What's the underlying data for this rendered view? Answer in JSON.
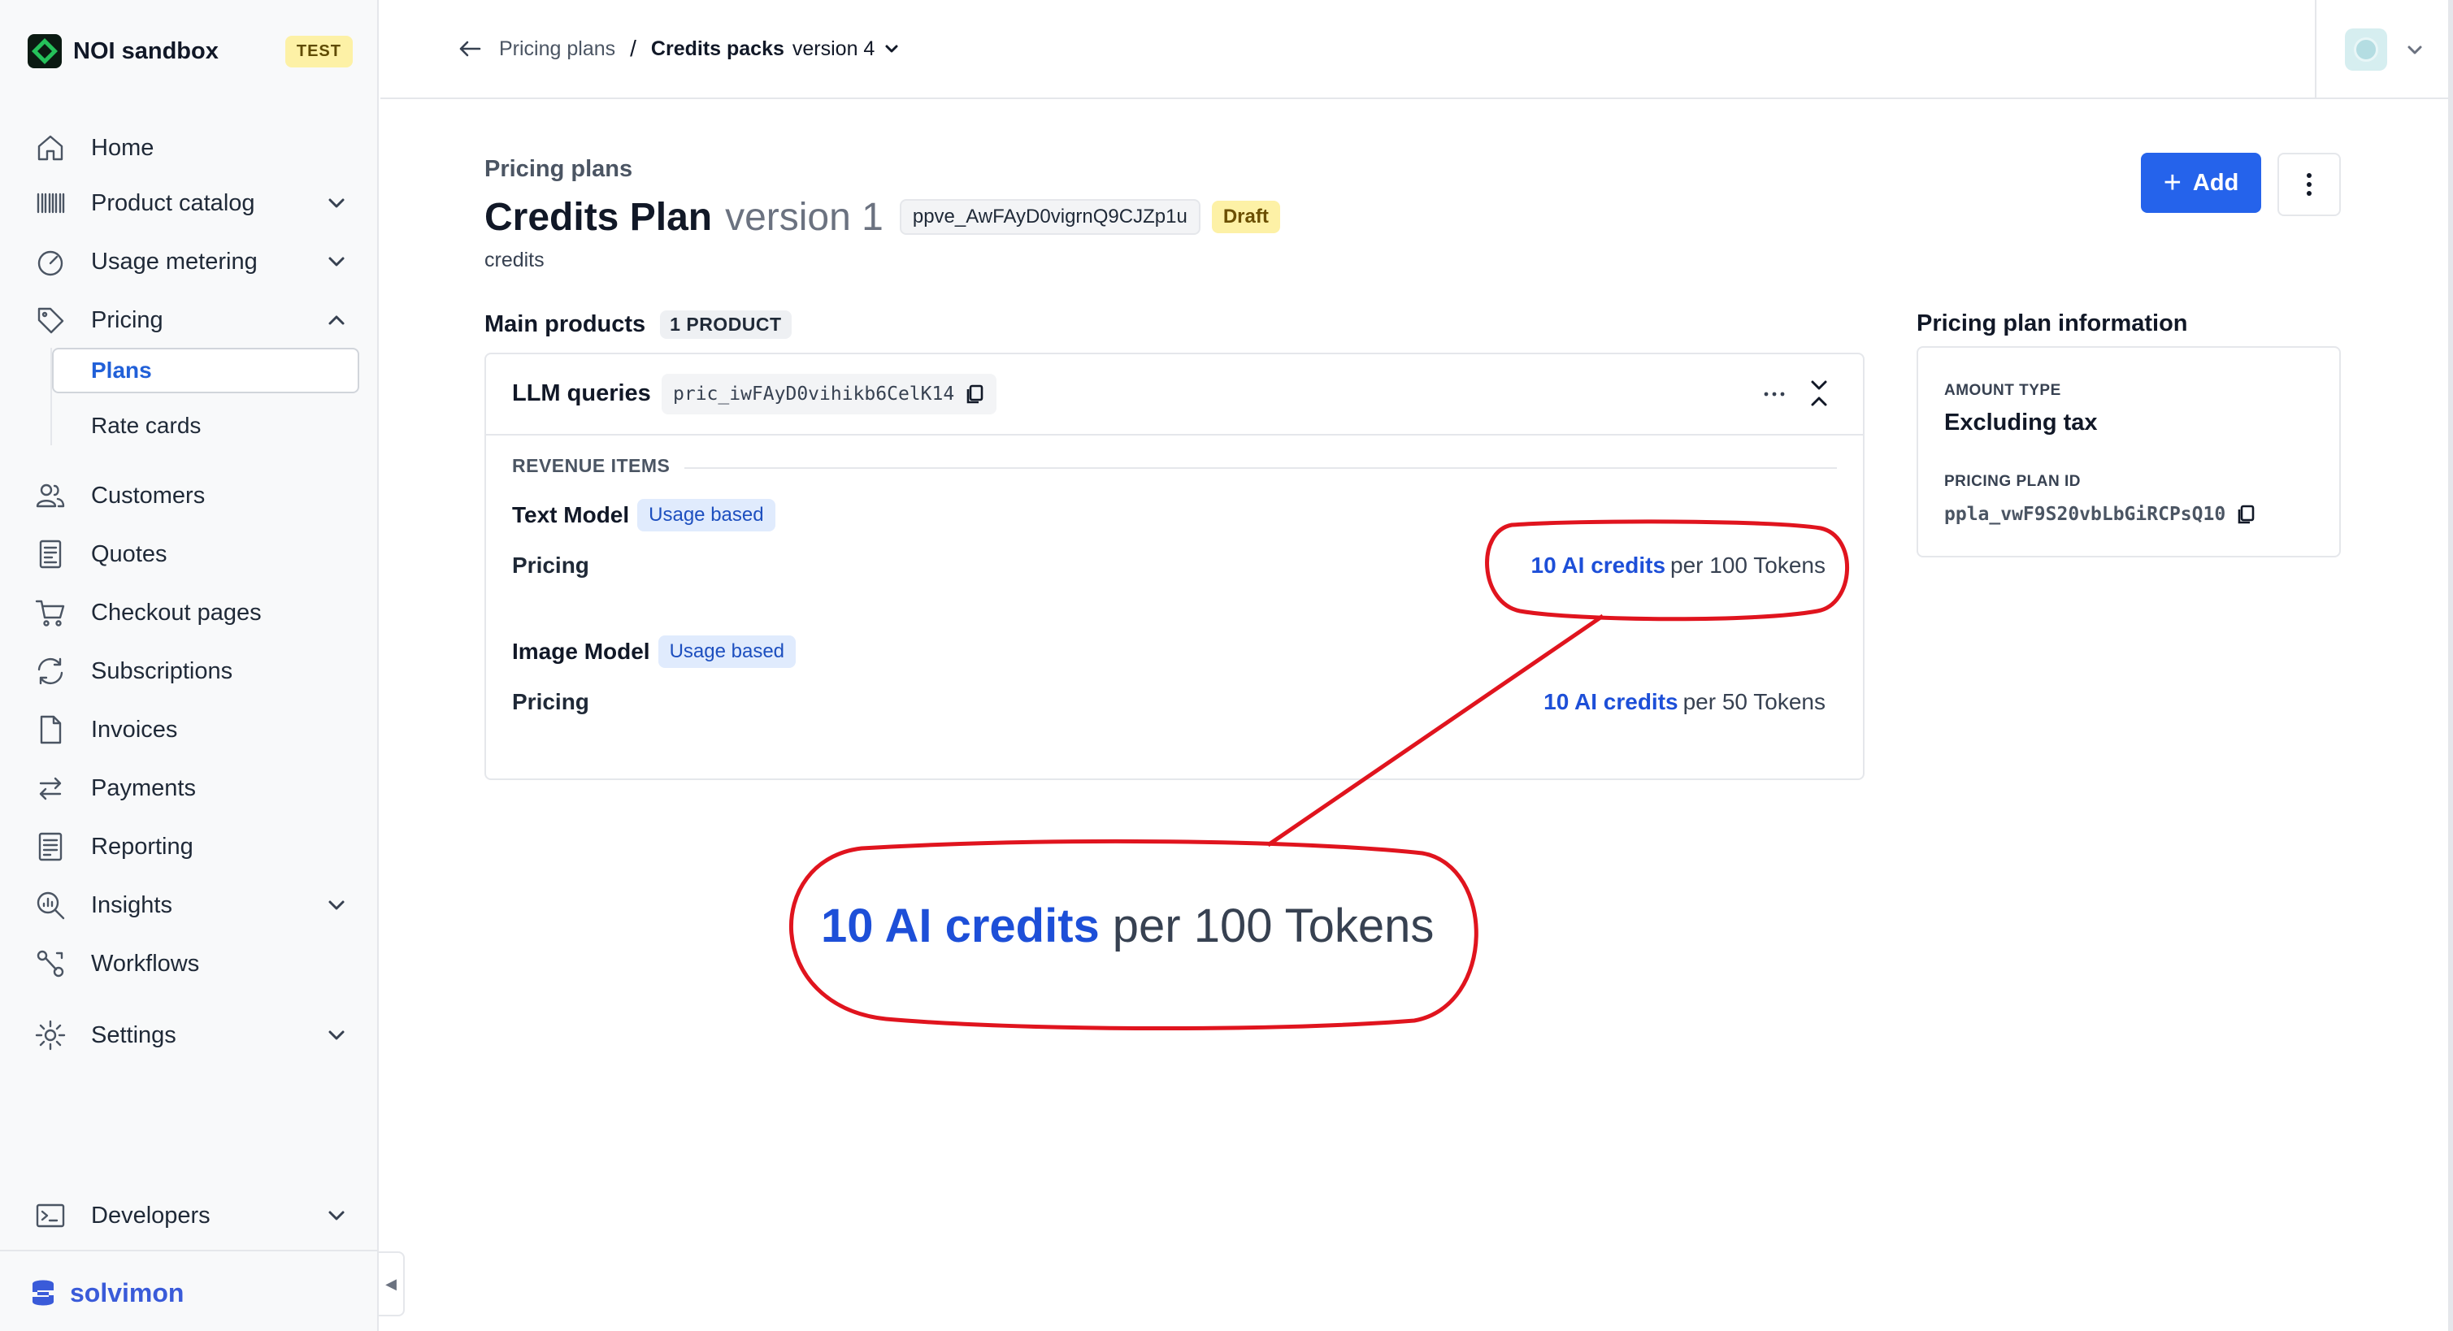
{
  "org": {
    "name": "NOI sandbox",
    "env_badge": "TEST"
  },
  "nav": {
    "items": [
      {
        "label": "Home",
        "icon": "home-icon"
      },
      {
        "label": "Product catalog",
        "icon": "barcode-icon"
      },
      {
        "label": "Usage metering",
        "icon": "gauge-icon"
      },
      {
        "label": "Pricing",
        "icon": "tag-icon"
      },
      {
        "label": "Customers",
        "icon": "users-icon"
      },
      {
        "label": "Quotes",
        "icon": "quote-doc-icon"
      },
      {
        "label": "Checkout pages",
        "icon": "cart-icon"
      },
      {
        "label": "Subscriptions",
        "icon": "refresh-icon"
      },
      {
        "label": "Invoices",
        "icon": "file-icon"
      },
      {
        "label": "Payments",
        "icon": "transfer-icon"
      },
      {
        "label": "Reporting",
        "icon": "report-icon"
      },
      {
        "label": "Insights",
        "icon": "insights-icon"
      },
      {
        "label": "Workflows",
        "icon": "workflow-icon"
      },
      {
        "label": "Settings",
        "icon": "gear-icon"
      },
      {
        "label": "Developers",
        "icon": "terminal-icon"
      }
    ],
    "pricing_sub": [
      {
        "label": "Plans",
        "active": true
      },
      {
        "label": "Rate cards",
        "active": false
      }
    ]
  },
  "brand": {
    "name": "solvimon"
  },
  "breadcrumb": {
    "parent": "Pricing plans",
    "separator": "/",
    "current": "Credits packs",
    "version": "version 4"
  },
  "page": {
    "eyebrow": "Pricing plans",
    "title": "Credits Plan",
    "version": "version 1",
    "id": "ppve_AwFAyD0vigrnQ9CJZp1u",
    "status": "Draft",
    "code": "credits",
    "add_label": "Add"
  },
  "main_products": {
    "title": "Main products",
    "count": "1 PRODUCT",
    "product": {
      "name": "LLM queries",
      "price_id": "pric_iwFAyD0vihikb6CelK14",
      "revenue_label": "REVENUE ITEMS",
      "items": [
        {
          "name": "Text Model",
          "badge": "Usage based",
          "pricing_label": "Pricing",
          "amount": "10 AI credits",
          "rate": "per 100 Tokens"
        },
        {
          "name": "Image Model",
          "badge": "Usage based",
          "pricing_label": "Pricing",
          "amount": "10 AI credits",
          "rate": "per 50 Tokens"
        }
      ]
    }
  },
  "info": {
    "title": "Pricing plan information",
    "amount_type_label": "AMOUNT TYPE",
    "amount_type_value": "Excluding tax",
    "plan_id_label": "PRICING PLAN ID",
    "plan_id_value": "ppla_vwF9S20vbLbGiRCPsQ10"
  },
  "annotation": {
    "amount": "10 AI credits",
    "rate": "per 100 Tokens",
    "color": "#e0141e"
  },
  "colors": {
    "accent": "#2563eb",
    "link": "#1d4fd8",
    "badge_yellow": "#fdf1a6",
    "usage_chip": "#e0ebfd"
  }
}
